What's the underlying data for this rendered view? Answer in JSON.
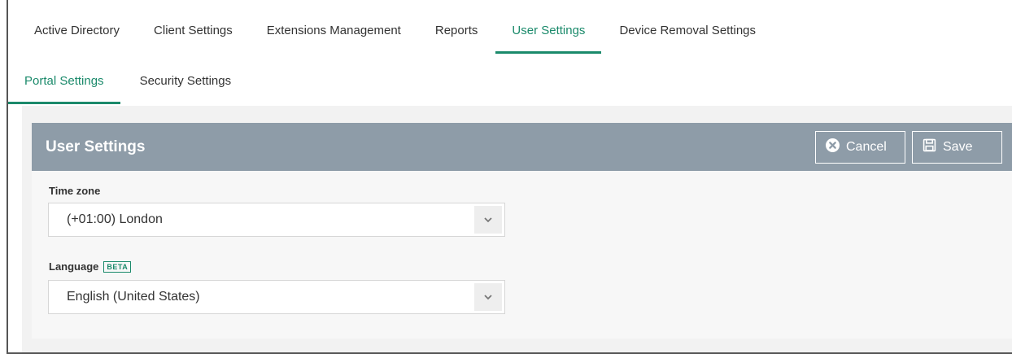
{
  "tabs_primary": [
    {
      "label": "Active Directory",
      "active": false
    },
    {
      "label": "Client Settings",
      "active": false
    },
    {
      "label": "Extensions Management",
      "active": false
    },
    {
      "label": "Reports",
      "active": false
    },
    {
      "label": "User Settings",
      "active": true
    },
    {
      "label": "Device Removal Settings",
      "active": false
    }
  ],
  "tabs_secondary": [
    {
      "label": "Portal Settings",
      "active": true
    },
    {
      "label": "Security Settings",
      "active": false
    }
  ],
  "panel": {
    "title": "User Settings",
    "cancel_label": "Cancel",
    "save_label": "Save"
  },
  "fields": {
    "timezone": {
      "label": "Time zone",
      "value": "(+01:00) London"
    },
    "language": {
      "label": "Language",
      "badge": "BETA",
      "value": "English (United States)"
    }
  },
  "colors": {
    "accent": "#1b8a6b",
    "header_bg": "#8e9ca8"
  },
  "icons": {
    "cancel": "cancel-circle-icon",
    "save": "floppy-disk-icon",
    "dropdown": "chevron-down-icon"
  }
}
